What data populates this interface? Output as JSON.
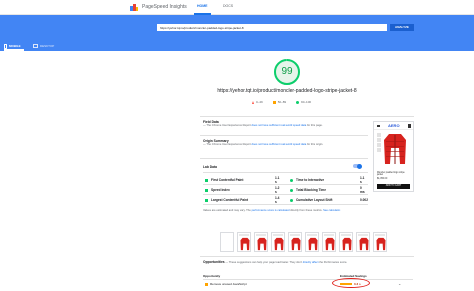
{
  "header": {
    "app_title": "PageSpeed Insights",
    "nav_home": "HOME",
    "nav_docs": "DOCS"
  },
  "search": {
    "url": "https://yehor.tqt.io/product/moncler-padded-logo-stripe-jacket-8",
    "analyze_label": "ANALYZE"
  },
  "device_tabs": {
    "mobile": "MOBILE",
    "desktop": "DESKTOP"
  },
  "score": {
    "value": "99",
    "color": "#0c9d46",
    "tested_url": "https://yehor.tqt.io/product/moncler-padded-logo-stripe-jacket-8",
    "fraction": 0.99
  },
  "legend": {
    "poor": "0–49",
    "average": "50–89",
    "good": "90–100"
  },
  "field_data": {
    "title": "Field Data",
    "text_a": "— The Chrome User Experience Report",
    "link": "does not have sufficient real-world speed data",
    "text_b": "for this page."
  },
  "origin_summary": {
    "title": "Origin Summary",
    "text_a": "— The Chrome User Experience Report",
    "link": "does not have sufficient real-world speed data",
    "text_b": "for this origin."
  },
  "lab_data": {
    "title": "Lab Data",
    "metrics": [
      {
        "name": "First Contentful Paint",
        "value": "1.1 s"
      },
      {
        "name": "Time to Interactive",
        "value": "1.1 s"
      },
      {
        "name": "Speed Index",
        "value": "1.2 s"
      },
      {
        "name": "Total Blocking Time",
        "value": "0 ms"
      },
      {
        "name": "Largest Contentful Paint",
        "value": "1.4 s"
      },
      {
        "name": "Cumulative Layout Shift",
        "value": "0.002"
      }
    ],
    "note_a": "Values are estimated and may vary. The",
    "note_link": "performance score is calculated",
    "note_b": "directly from these metrics.",
    "calc_link": "See calculator."
  },
  "preview": {
    "logo": "AERO",
    "product_title": "Moncler padded logo stripe jacket",
    "price": "$1,050.00",
    "cta": "ADD TO CART",
    "jacket_color": "#d7231e"
  },
  "opportunities": {
    "title": "Opportunities",
    "desc_a": "— These suggestions can help your page load faster. They don't",
    "desc_link": "directly affect",
    "desc_b": "the Performance score.",
    "col_opportunity": "Opportunity",
    "col_savings": "Estimated Savings",
    "rows": [
      {
        "label": "Remove unused JavaScript",
        "savings": "0.3 s"
      }
    ]
  }
}
